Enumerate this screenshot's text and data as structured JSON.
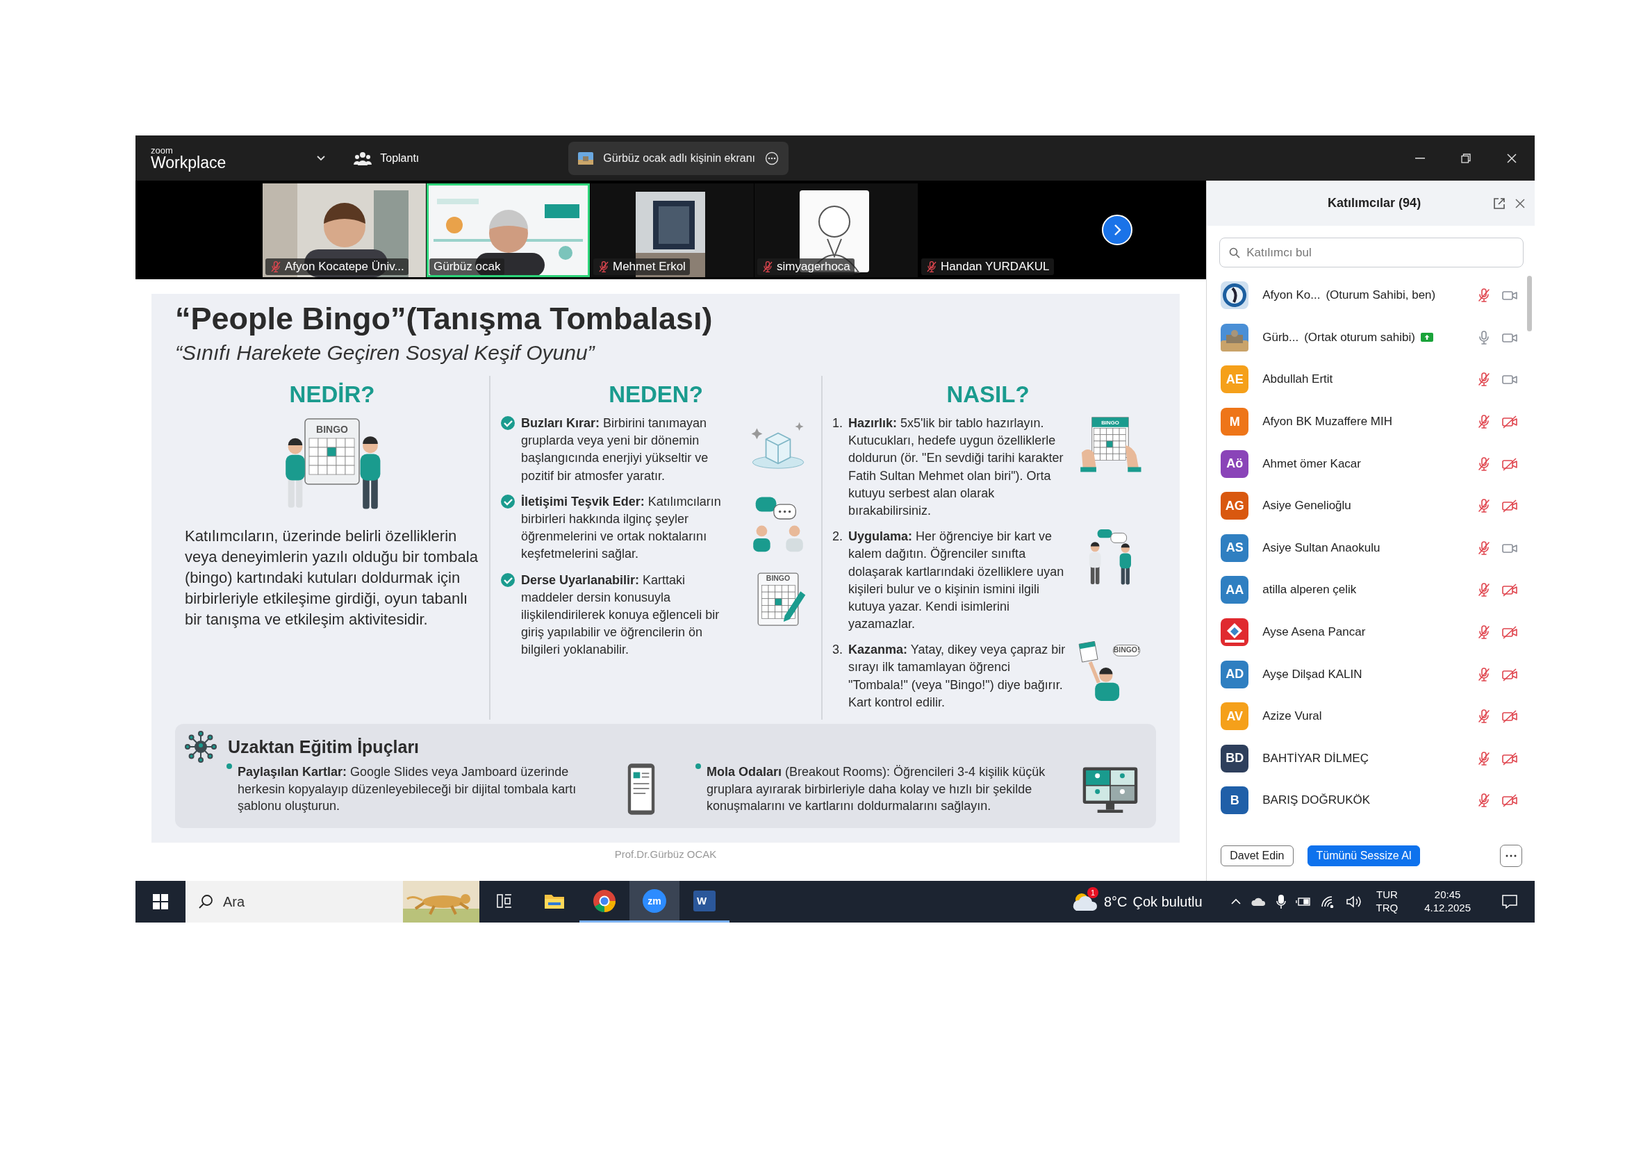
{
  "window": {
    "logo_small": "zoom",
    "logo": "Workplace",
    "meeting_label": "Toplantı",
    "share_banner": "Gürbüz ocak adlı kişinin ekranı"
  },
  "thumbnails": [
    {
      "name": "Afyon Kocatepe Üniv...",
      "muted": true,
      "selected": false,
      "video": true
    },
    {
      "name": "Gürbüz ocak",
      "muted": false,
      "selected": true,
      "video": true
    },
    {
      "name": "Mehmet Erkol",
      "muted": true,
      "selected": false,
      "video": true
    },
    {
      "name": "simyagerhoca",
      "muted": true,
      "selected": false,
      "video": true
    },
    {
      "name": "Handan YURDAKUL",
      "muted": true,
      "selected": false,
      "video": false
    }
  ],
  "slide": {
    "title": "“People Bingo”(Tanışma Tombalası)",
    "subtitle": "“Sınıfı Harekete Geçiren Sosyal Keşif Oyunu”",
    "columns": [
      {
        "kind": "paragraph",
        "heading": "NEDİR?",
        "art_label": "BINGO",
        "text": "Katılımcıların, üzerinde belirli özelliklerin veya deneyimlerin yazılı olduğu bir tombala (bingo) kartındaki kutuları doldurmak için birbirleriyle etkileşime girdiği, oyun tabanlı bir tanışma ve etkileşim aktivitesidir."
      },
      {
        "kind": "checklist",
        "heading": "NEDEN?",
        "items": [
          {
            "kind": "ice",
            "text": "**Buzları Kırar:** Birbirini tanımayan gruplarda veya yeni bir dönemin başlangıcında enerjiyi yükseltir ve pozitif bir atmosfer yaratır."
          },
          {
            "kind": "chat",
            "text": "**İletişimi Teşvik Eder:** Katılımcıların birbirleri hakkında ilginç şeyler öğrenmelerini ve ortak noktalarını keşfetmelerini sağlar."
          },
          {
            "kind": "card",
            "art_label": "BINGO",
            "text": "**Derse Uyarlanabilir:** Karttaki maddeler dersin konusuyla ilişkilendirilerek konuya eğlenceli bir giriş yapılabilir ve öğrencilerin ön bilgileri yoklanabilir."
          }
        ]
      },
      {
        "kind": "numbered",
        "heading": "NASIL?",
        "items": [
          {
            "kind": "hands",
            "number": "1.",
            "art_label": "BINGO",
            "text": "**Hazırlık:** 5x5'lik bir tablo hazırlayın. Kutucukları, hedefe uygun özelliklerle doldurun (ör. \"En sevdiği tarihi karakter Fatih Sultan Mehmet olan biri\"). Orta kutuyu serbest alan olarak bırakabilirsiniz."
          },
          {
            "kind": "pair",
            "number": "2.",
            "text": "**Uygulama:** Her öğrenciye bir kart ve kalem dağıtın. Öğrenciler sınıfta dolaşarak kartlarındaki özelliklere uyan kişileri bulur ve o kişinin ismini ilgili kutuya yazar. Kendi isimlerini yazamazlar."
          },
          {
            "kind": "winner",
            "number": "3.",
            "art_label": "BINGO!",
            "text": "**Kazanma:** Yatay, dikey veya çapraz bir sırayı ilk tamamlayan öğrenci \"Tombala!\" (veya \"Bingo!\") diye bağırır. Kart kontrol edilir."
          }
        ]
      }
    ],
    "tips": {
      "heading": "Uzaktan Eğitim İpuçları",
      "items": [
        {
          "kind": "tablet",
          "text": "**Paylaşılan Kartlar:** Google Slides veya Jamboard üzerinde herkesin kopyalayıp düzenleyebileceği bir dijital tombala kartı şablonu oluşturun."
        },
        {
          "kind": "monitor",
          "text": "**Mola Odaları** (Breakout Rooms): Öğrencileri 3-4 kişilik küçük gruplara ayırarak birbirleriyle daha kolay ve hızlı bir şekilde konuşmalarını ve kartlarını doldurmalarını sağlayın."
        }
      ]
    },
    "footer": "Prof.Dr.Gürbüz OCAK"
  },
  "panel": {
    "title": "Katılımcılar (94)",
    "search": {
      "placeholder": "Katılımcı bul"
    },
    "participants": [
      {
        "kind": "picture",
        "name": "Afyon Ko...",
        "role": "(Oturum Sahibi, ben)",
        "sharing": false,
        "muted": true,
        "video": true
      },
      {
        "kind": "picture",
        "name": "Gürb...",
        "role": "(Ortak oturum sahibi)",
        "sharing": true,
        "muted": false,
        "video": true
      },
      {
        "kind": "initials",
        "initials": "AE",
        "color": "#f5a01a",
        "name": "Abdullah Ertit",
        "sharing": false,
        "muted": true,
        "video": true
      },
      {
        "kind": "initials",
        "initials": "M",
        "color": "#ee7518",
        "name": "Afyon BK Muzaffere MIH",
        "sharing": false,
        "muted": true,
        "video": false
      },
      {
        "kind": "initials",
        "initials": "Aö",
        "color": "#8a44b8",
        "name": "Ahmet ömer Kacar",
        "sharing": false,
        "muted": true,
        "video": false
      },
      {
        "kind": "initials",
        "initials": "AG",
        "color": "#d9580f",
        "name": "Asiye Genelioğlu",
        "sharing": false,
        "muted": true,
        "video": false
      },
      {
        "kind": "initials",
        "initials": "AS",
        "color": "#2f7fc1",
        "name": "Asiye Sultan Anaokulu",
        "sharing": false,
        "muted": true,
        "video": true
      },
      {
        "kind": "initials",
        "initials": "AA",
        "color": "#2f7fc1",
        "name": "atilla alperen çelik",
        "sharing": false,
        "muted": true,
        "video": false
      },
      {
        "kind": "picture",
        "name": "Ayse Asena Pancar",
        "sharing": false,
        "muted": true,
        "video": false
      },
      {
        "kind": "initials",
        "initials": "AD",
        "color": "#2f7fc1",
        "name": "Ayşe Dilşad KALIN",
        "sharing": false,
        "muted": true,
        "video": false
      },
      {
        "kind": "initials",
        "initials": "AV",
        "color": "#f5a01a",
        "name": "Azize Vural",
        "sharing": false,
        "muted": true,
        "video": false
      },
      {
        "kind": "initials",
        "initials": "BD",
        "color": "#2e3f5c",
        "name": "BAHTİYAR DİLMEÇ",
        "sharing": false,
        "muted": true,
        "video": false
      },
      {
        "kind": "initials",
        "initials": "B",
        "color": "#1f5fa8",
        "name": "BARIŞ DOĞRUKÖK",
        "sharing": false,
        "muted": true,
        "video": false
      }
    ],
    "buttons": [
      {
        "kind": "outline",
        "label": "Davet Edin"
      },
      {
        "kind": "primary",
        "label": "Tümünü Sessize Al"
      }
    ]
  },
  "taskbar": {
    "search": {
      "placeholder": "Ara"
    },
    "apps": [
      {
        "kind": "taskview",
        "running": false,
        "selected": false
      },
      {
        "kind": "explorer",
        "running": false,
        "selected": false
      },
      {
        "kind": "chrome",
        "running": true,
        "selected": false
      },
      {
        "kind": "zoom",
        "label": "zm",
        "running": true,
        "selected": true
      },
      {
        "kind": "word",
        "label": "W",
        "running": true,
        "selected": false
      }
    ],
    "weather": {
      "badge": "1",
      "temperature": "8°C",
      "condition": "Çok bulutlu"
    },
    "language": [
      "TUR",
      "TRQ"
    ],
    "time": "20:45",
    "date": "4.12.2025"
  }
}
